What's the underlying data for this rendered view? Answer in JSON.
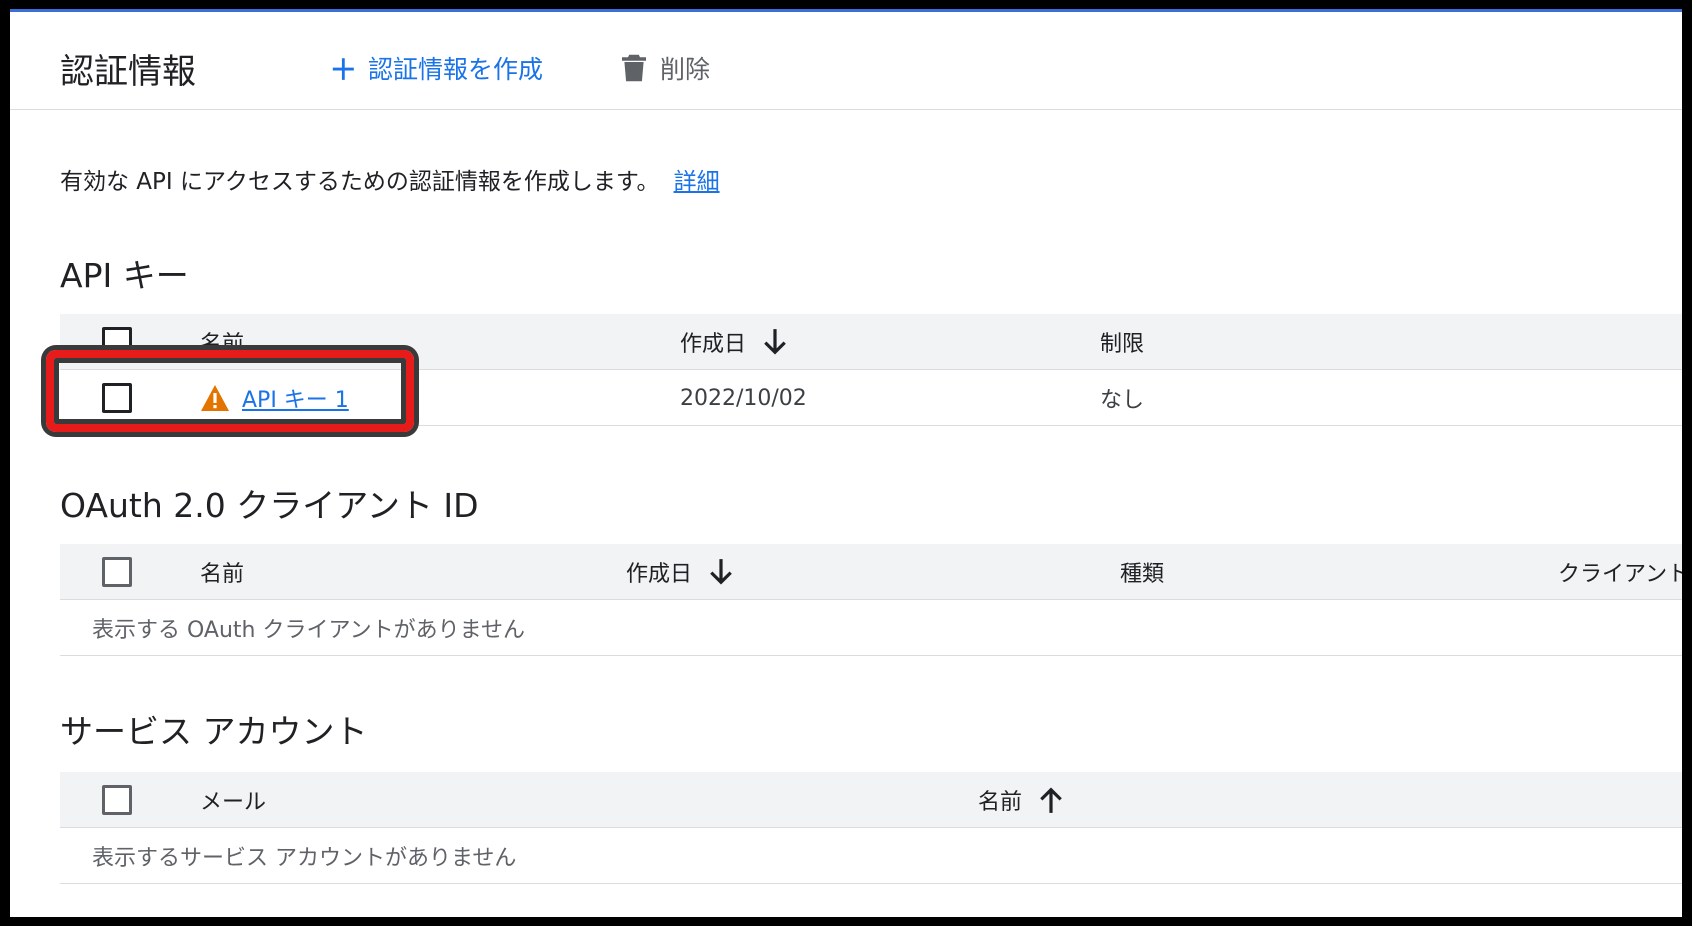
{
  "header": {
    "title": "認証情報",
    "create_label": "認証情報を作成",
    "delete_label": "削除"
  },
  "intro": {
    "text": "有効な API にアクセスするための認証情報を作成します。",
    "link": "詳細"
  },
  "api_keys": {
    "title": "API キー",
    "columns": [
      "名前",
      "作成日",
      "制限"
    ],
    "rows": [
      {
        "name": "API キー 1",
        "created": "2022/10/02",
        "restriction": "なし"
      }
    ]
  },
  "oauth": {
    "title": "OAuth 2.0 クライアント ID",
    "columns": [
      "名前",
      "作成日",
      "種類",
      "クライアント"
    ],
    "empty": "表示する OAuth クライアントがありません"
  },
  "service_accounts": {
    "title": "サービス アカウント",
    "columns": [
      "メール",
      "名前"
    ],
    "empty": "表示するサービス アカウントがありません"
  },
  "colors": {
    "accent": "#1a73e8",
    "warning": "#e37400",
    "highlight": "#e81b1b"
  }
}
